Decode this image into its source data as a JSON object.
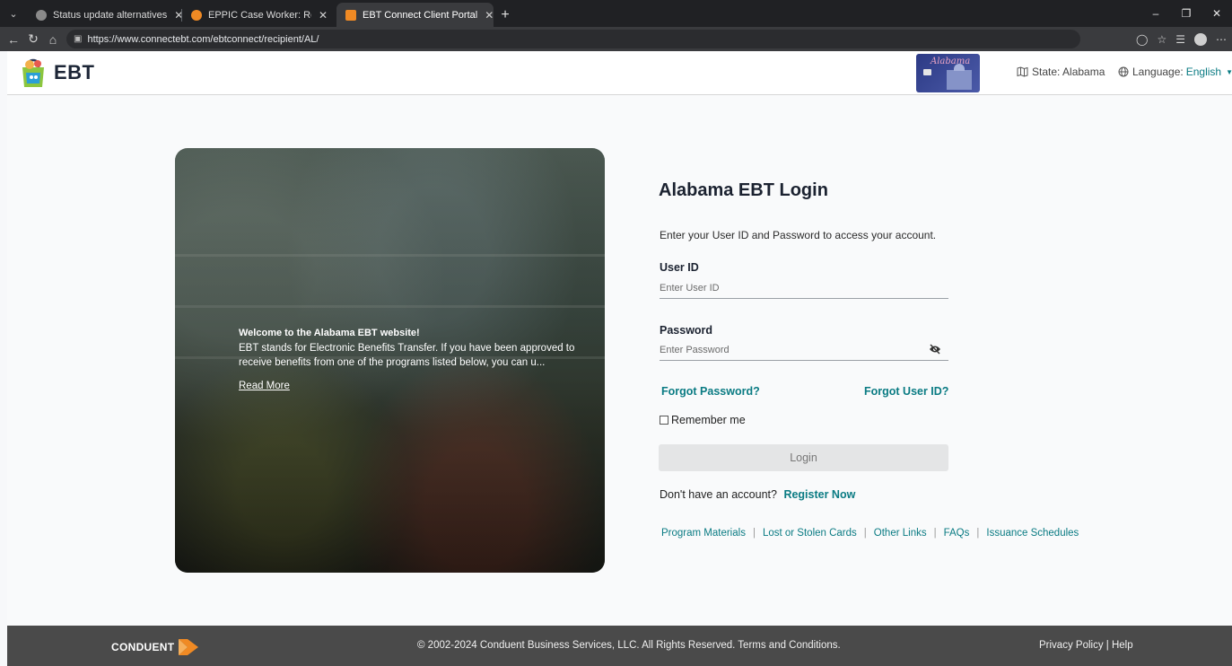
{
  "browser": {
    "tabs": [
      {
        "title": "Status update alternatives",
        "favicon_color": "#8a8a8a",
        "active": false
      },
      {
        "title": "EPPIC Case Worker: Recipient Car",
        "favicon_color": "#f08a24",
        "active": false
      },
      {
        "title": "EBT Connect Client Portal",
        "favicon_color": "#f08a24",
        "active": true
      }
    ],
    "url": "https://www.connectebt.com/ebtconnect/recipient/AL/"
  },
  "header": {
    "logo_text": "EBT",
    "card_script": "Alabama",
    "state_label": "State: Alabama",
    "language_label": "Language:",
    "language_value": "English"
  },
  "hero": {
    "title": "Welcome to the Alabama EBT website!",
    "text": "EBT stands for Electronic Benefits Transfer. If you have been approved to receive benefits from one of the programs listed below, you can u...",
    "read_more": "Read More"
  },
  "login": {
    "title": "Alabama EBT Login",
    "description": "Enter your User ID and Password to access your account.",
    "user_id_label": "User ID",
    "user_id_placeholder": "Enter User ID",
    "password_label": "Password",
    "password_placeholder": "Enter Password",
    "forgot_password": "Forgot Password?",
    "forgot_user_id": "Forgot User ID?",
    "remember_me": "Remember me",
    "login_button": "Login",
    "no_account": "Don't have an account?",
    "register_now": "Register Now",
    "links": [
      "Program Materials",
      "Lost or Stolen Cards",
      "Other Links",
      "FAQs",
      "Issuance Schedules"
    ]
  },
  "footer": {
    "logo_text": "CONDUENT",
    "copyright": "2002-2024 Conduent Business Services, LLC. All Rights Reserved. Terms and Conditions.",
    "privacy": "Privacy Policy",
    "help": "Help"
  },
  "colors": {
    "accent": "#0a7b83",
    "footer_bg": "#4a4a4a",
    "title": "#1b2230"
  }
}
